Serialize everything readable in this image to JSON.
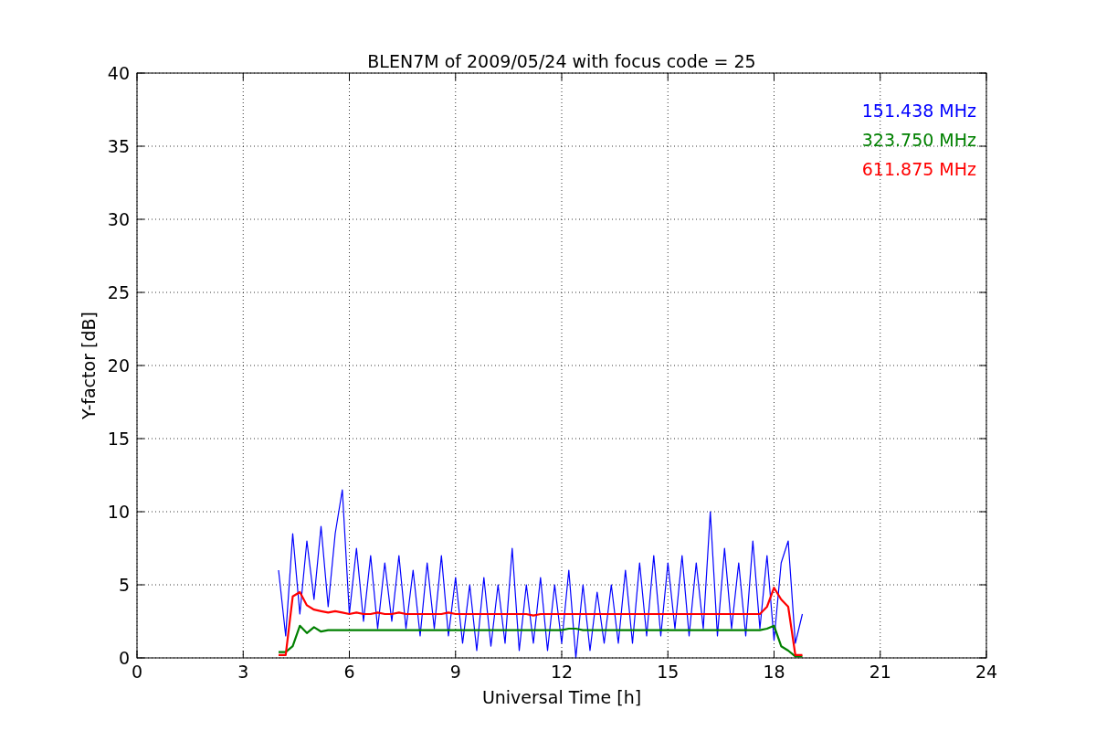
{
  "chart_data": {
    "type": "line",
    "title": "BLEN7M of 2009/05/24 with focus code = 25",
    "xlabel": "Universal Time [h]",
    "ylabel": "Y-factor [dB]",
    "grid": true,
    "xlim": [
      0,
      24
    ],
    "ylim": [
      0,
      40
    ],
    "xticks": [
      0,
      3,
      6,
      9,
      12,
      15,
      18,
      21,
      24
    ],
    "yticks": [
      0,
      5,
      10,
      15,
      20,
      25,
      30,
      35,
      40
    ],
    "x": [
      4.0,
      4.2,
      4.4,
      4.6,
      4.8,
      5.0,
      5.2,
      5.4,
      5.6,
      5.8,
      6.0,
      6.2,
      6.4,
      6.6,
      6.8,
      7.0,
      7.2,
      7.4,
      7.6,
      7.8,
      8.0,
      8.2,
      8.4,
      8.6,
      8.8,
      9.0,
      9.2,
      9.4,
      9.6,
      9.8,
      10.0,
      10.2,
      10.4,
      10.6,
      10.8,
      11.0,
      11.2,
      11.4,
      11.6,
      11.8,
      12.0,
      12.2,
      12.4,
      12.6,
      12.8,
      13.0,
      13.2,
      13.4,
      13.6,
      13.8,
      14.0,
      14.2,
      14.4,
      14.6,
      14.8,
      15.0,
      15.2,
      15.4,
      15.6,
      15.8,
      16.0,
      16.2,
      16.4,
      16.6,
      16.8,
      17.0,
      17.2,
      17.4,
      17.6,
      17.8,
      18.0,
      18.2,
      18.4,
      18.6,
      18.8
    ],
    "series": [
      {
        "name": "151.438 MHz",
        "color": "#0000ff",
        "values": [
          6.0,
          1.5,
          8.5,
          3.0,
          8.0,
          4.0,
          9.0,
          3.5,
          8.5,
          11.5,
          3.0,
          7.5,
          2.5,
          7.0,
          2.0,
          6.5,
          2.5,
          7.0,
          2.0,
          6.0,
          1.5,
          6.5,
          2.0,
          7.0,
          1.5,
          5.5,
          1.0,
          5.0,
          0.5,
          5.5,
          0.8,
          5.0,
          1.0,
          7.5,
          0.5,
          5.0,
          1.0,
          5.5,
          0.5,
          5.0,
          1.0,
          6.0,
          0.0,
          5.0,
          0.5,
          4.5,
          1.0,
          5.0,
          1.0,
          6.0,
          1.0,
          6.5,
          1.5,
          7.0,
          1.5,
          6.5,
          2.0,
          7.0,
          1.5,
          6.5,
          2.0,
          10.0,
          1.5,
          7.5,
          2.0,
          6.5,
          1.5,
          8.0,
          2.0,
          7.0,
          1.2,
          6.5,
          8.0,
          1.0,
          3.0
        ]
      },
      {
        "name": "323.750 MHz",
        "color": "#008000",
        "values": [
          0.4,
          0.4,
          0.8,
          2.2,
          1.7,
          2.1,
          1.8,
          1.9,
          1.9,
          1.9,
          1.9,
          1.9,
          1.9,
          1.9,
          1.9,
          1.9,
          1.9,
          1.9,
          1.9,
          1.9,
          1.9,
          1.9,
          1.9,
          1.9,
          1.9,
          1.9,
          1.9,
          1.9,
          1.9,
          1.9,
          1.9,
          1.9,
          1.9,
          1.9,
          1.9,
          1.9,
          1.9,
          1.9,
          1.9,
          1.9,
          1.9,
          2.0,
          2.0,
          1.9,
          1.9,
          1.9,
          1.9,
          1.9,
          1.9,
          1.9,
          1.9,
          1.9,
          1.9,
          1.9,
          1.9,
          1.9,
          1.9,
          1.9,
          1.9,
          1.9,
          1.9,
          1.9,
          1.9,
          1.9,
          1.9,
          1.9,
          1.9,
          1.9,
          1.9,
          2.0,
          2.2,
          0.8,
          0.5,
          0.1,
          0.1
        ]
      },
      {
        "name": "611.875 MHz",
        "color": "#ff0000",
        "values": [
          0.2,
          0.2,
          4.2,
          4.5,
          3.6,
          3.3,
          3.2,
          3.1,
          3.2,
          3.1,
          3.0,
          3.1,
          3.0,
          3.0,
          3.1,
          3.0,
          3.0,
          3.1,
          3.0,
          3.0,
          3.0,
          3.0,
          3.0,
          3.0,
          3.1,
          3.0,
          3.0,
          3.0,
          3.0,
          3.0,
          3.0,
          3.0,
          3.0,
          3.0,
          3.0,
          3.0,
          2.9,
          3.0,
          3.0,
          3.0,
          3.0,
          3.0,
          3.0,
          3.0,
          3.0,
          3.0,
          3.0,
          3.0,
          3.0,
          3.0,
          3.0,
          3.0,
          3.0,
          3.0,
          3.0,
          3.0,
          3.0,
          3.0,
          3.0,
          3.0,
          3.0,
          3.0,
          3.0,
          3.0,
          3.0,
          3.0,
          3.0,
          3.0,
          3.0,
          3.5,
          4.8,
          4.0,
          3.5,
          0.2,
          0.2
        ]
      }
    ]
  }
}
